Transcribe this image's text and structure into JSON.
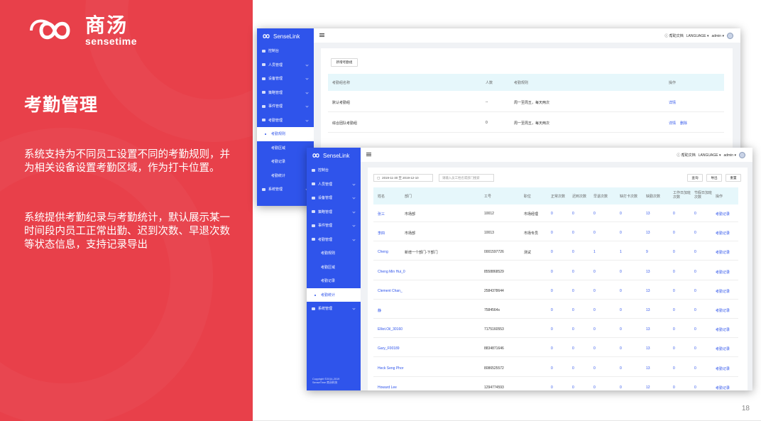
{
  "slide": {
    "logo_cn": "商汤",
    "logo_en": "sensetime",
    "title": "考勤管理",
    "para1": "系统支持为不同员工设置不同的考勤规则，并为相关设备设置考勤区域，作为打卡位置。",
    "para2": "系统提供考勤纪录与考勤统计，默认展示某一时间段内员工正常出勤、迟到次数、早退次数等状态信息，支持记录导出",
    "page_number": "18"
  },
  "app": {
    "brand": "SenseLink",
    "help_label": "帮助文档",
    "language_label": "LANGUAGE",
    "user_label": "admin",
    "copyright": "Copyright ©2014-2019\nSenseTime 商汤科技"
  },
  "screen1": {
    "nav": [
      {
        "label": "控制台",
        "sub": false
      },
      {
        "label": "人员管理",
        "sub": false,
        "chev": true
      },
      {
        "label": "设备管理",
        "sub": false,
        "chev": true
      },
      {
        "label": "策略管理",
        "sub": false,
        "chev": true
      },
      {
        "label": "事件管理",
        "sub": false,
        "chev": true
      },
      {
        "label": "考勤管理",
        "sub": false,
        "chev": true
      },
      {
        "label": "考勤规则",
        "sub": true,
        "active": true
      },
      {
        "label": "考勤区域",
        "sub": true
      },
      {
        "label": "考勤记录",
        "sub": true
      },
      {
        "label": "考勤统计",
        "sub": true
      },
      {
        "label": "系统管理",
        "sub": false,
        "chev": true
      }
    ],
    "add_button": "新增考勤组",
    "headers": [
      "考勤组名称",
      "人数",
      "考勤规则",
      "操作"
    ],
    "rows": [
      {
        "name": "默认考勤组",
        "count": "--",
        "rule": "周一至周五，每天两次",
        "actions": [
          "详情"
        ]
      },
      {
        "name": "综合团队考勤组",
        "count": "0",
        "rule": "周一至周五，每天两次",
        "actions": [
          "详情",
          "删除"
        ]
      }
    ]
  },
  "screen2": {
    "nav": [
      {
        "label": "控制台",
        "sub": false
      },
      {
        "label": "人员管理",
        "sub": false,
        "chev": true
      },
      {
        "label": "设备管理",
        "sub": false,
        "chev": true
      },
      {
        "label": "策略管理",
        "sub": false,
        "chev": true
      },
      {
        "label": "事件管理",
        "sub": false,
        "chev": true
      },
      {
        "label": "考勤管理",
        "sub": false,
        "chev": true
      },
      {
        "label": "考勤规则",
        "sub": true
      },
      {
        "label": "考勤区域",
        "sub": true
      },
      {
        "label": "考勤记录",
        "sub": true
      },
      {
        "label": "考勤统计",
        "sub": true,
        "active": true
      },
      {
        "label": "系统管理",
        "sub": false,
        "chev": true
      }
    ],
    "date_range": "2019-11-30 至 2019-12-10",
    "search_placeholder": "请输入员工姓名或部门搜索",
    "buttons": [
      "查询",
      "导出",
      "重置"
    ],
    "headers": [
      "姓名",
      "部门",
      "工号",
      "职位",
      "正常次数",
      "迟到次数",
      "早退次数",
      "缺打卡次数",
      "缺勤次数",
      "工作日加班次数",
      "节假日加班次数",
      "操作"
    ],
    "rows": [
      {
        "name": "张三",
        "dept": "市场部",
        "id": "10012",
        "pos": "市场经理",
        "v": [
          "0",
          "0",
          "0",
          "0",
          "13",
          "0",
          "0"
        ]
      },
      {
        "name": "李四",
        "dept": "市场部",
        "id": "10013",
        "pos": "市场专员",
        "v": [
          "0",
          "0",
          "0",
          "0",
          "13",
          "0",
          "0"
        ]
      },
      {
        "name": "Cheng",
        "dept": "新增一个部门-下部门",
        "id": "0001597726",
        "pos": "测试",
        "v": [
          "0",
          "0",
          "1",
          "1",
          "9",
          "0",
          "0"
        ]
      },
      {
        "name": "Cheng Min Hui_0",
        "dept": "",
        "id": "8558868529",
        "pos": "",
        "v": [
          "0",
          "0",
          "0",
          "0",
          "13",
          "0",
          "0"
        ]
      },
      {
        "name": "Clement Chan_",
        "dept": "",
        "id": "2584378644",
        "pos": "",
        "v": [
          "0",
          "0",
          "0",
          "0",
          "13",
          "0",
          "0"
        ]
      },
      {
        "name": "静",
        "dept": "",
        "id": "7584564s",
        "pos": "",
        "v": [
          "0",
          "0",
          "0",
          "0",
          "13",
          "0",
          "0"
        ]
      },
      {
        "name": "Elliot.Oil_30160",
        "dept": "",
        "id": "7175160553",
        "pos": "",
        "v": [
          "0",
          "0",
          "0",
          "0",
          "13",
          "0",
          "0"
        ]
      },
      {
        "name": "Gary_F00189",
        "dept": "",
        "id": "8834871646",
        "pos": "",
        "v": [
          "0",
          "0",
          "0",
          "0",
          "13",
          "0",
          "0"
        ]
      },
      {
        "name": "Heck Seng Phor",
        "dept": "",
        "id": "8086525572",
        "pos": "",
        "v": [
          "0",
          "0",
          "0",
          "0",
          "13",
          "0",
          "0"
        ]
      },
      {
        "name": "Howard Lee",
        "dept": "",
        "id": "1294774593",
        "pos": "",
        "v": [
          "0",
          "0",
          "0",
          "0",
          "12",
          "0",
          "0"
        ]
      }
    ],
    "row_action": "考勤记录"
  }
}
